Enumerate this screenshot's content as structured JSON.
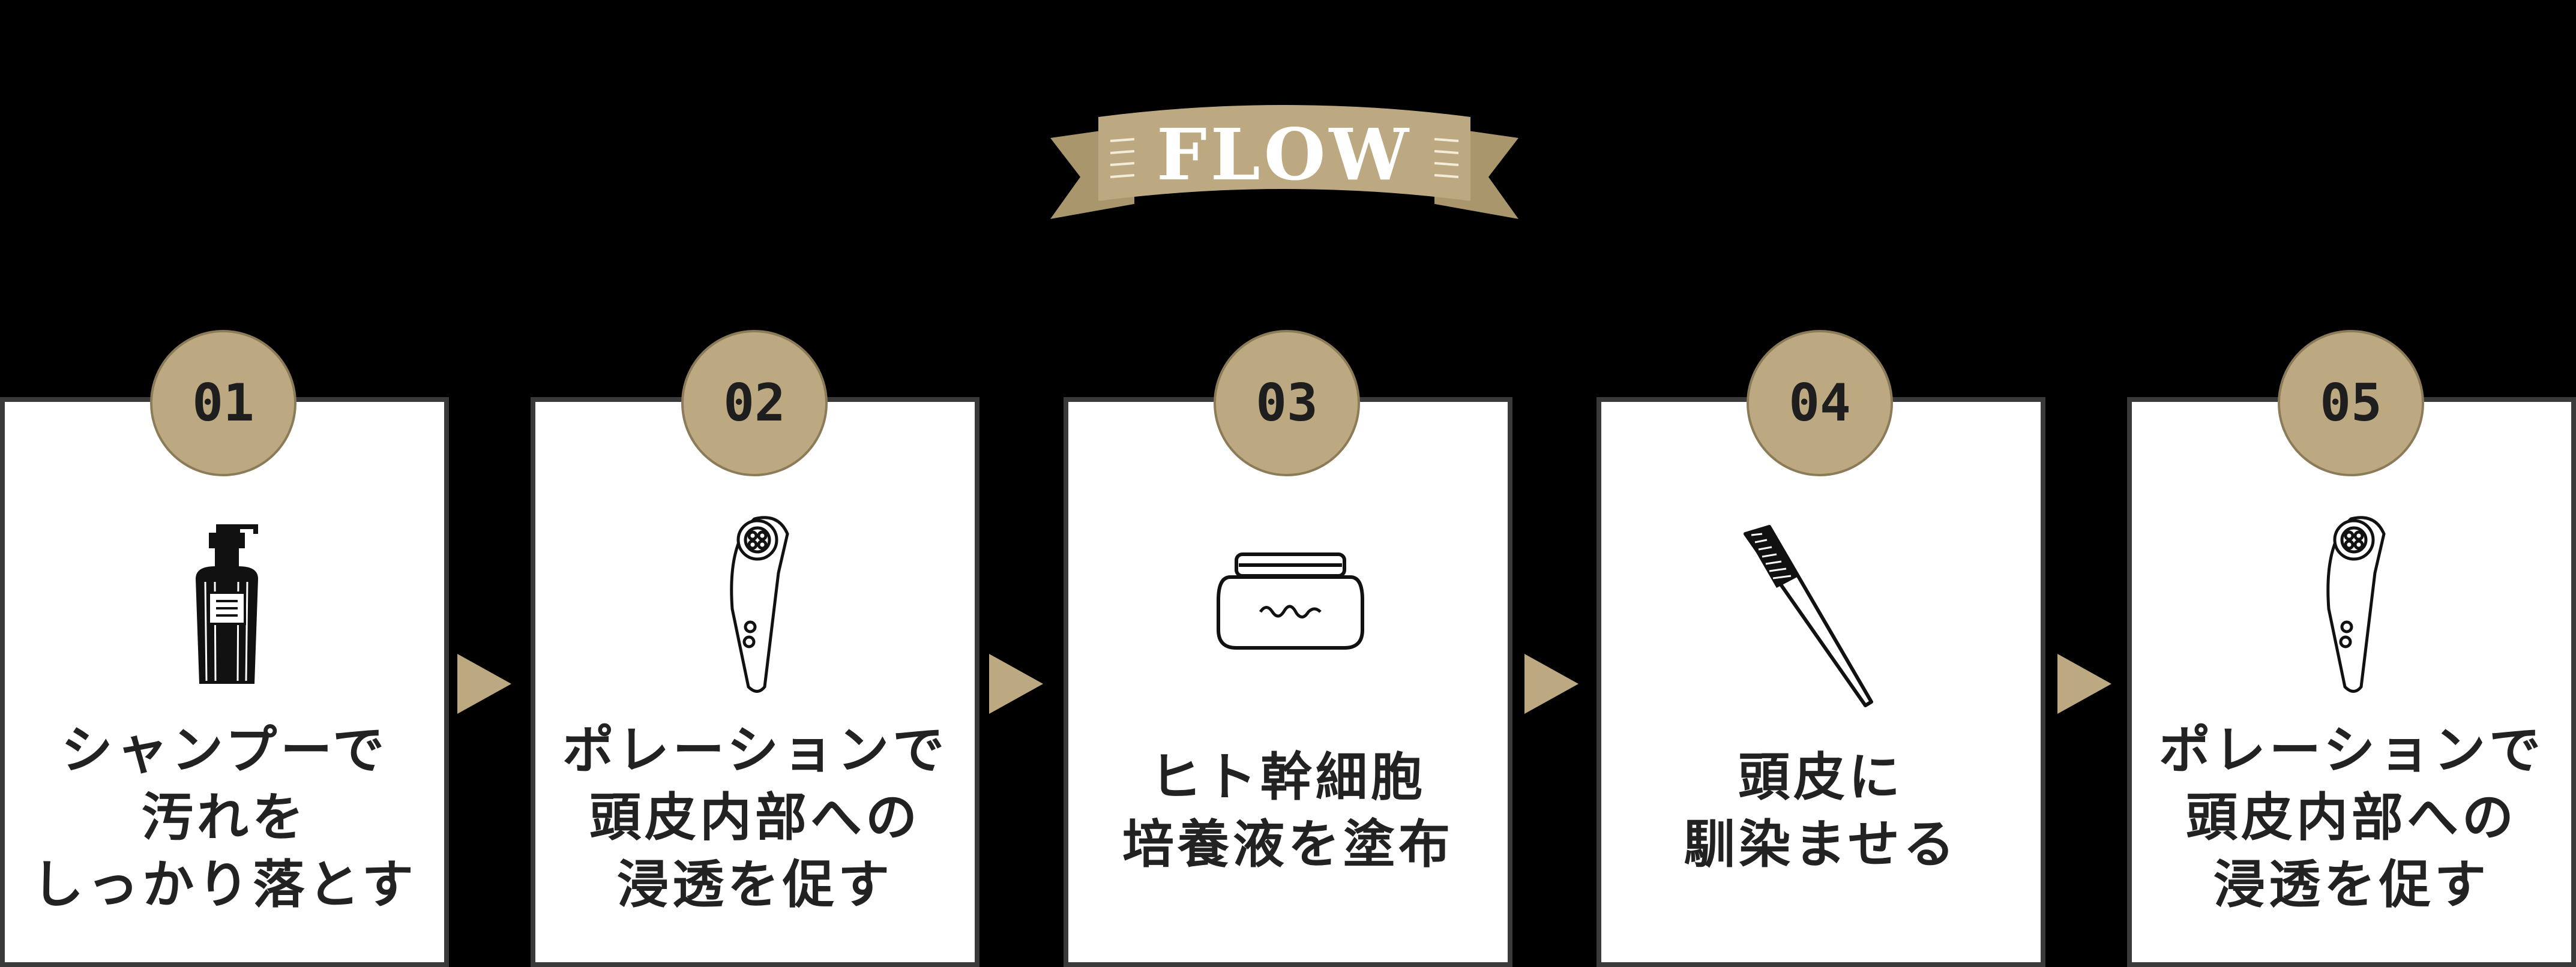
{
  "banner": {
    "title": "FLOW",
    "color": "#bda981"
  },
  "steps": [
    {
      "number": "01",
      "icon": "shampoo-bottle-icon",
      "text": "シャンプーで\n汚れを\nしっかり落とす"
    },
    {
      "number": "02",
      "icon": "poration-device-icon",
      "text": "ポレーションで\n頭皮内部への\n浸透を促す"
    },
    {
      "number": "03",
      "icon": "cream-jar-icon",
      "text": "ヒト幹細胞\n培養液を塗布"
    },
    {
      "number": "04",
      "icon": "comb-icon",
      "text": "頭皮に\n馴染ませる"
    },
    {
      "number": "05",
      "icon": "poration-device-icon",
      "text": "ポレーションで\n頭皮内部への\n浸透を促す"
    }
  ],
  "colors": {
    "background": "#000000",
    "accent": "#bda981",
    "card": "#ffffff",
    "text": "#222222"
  }
}
